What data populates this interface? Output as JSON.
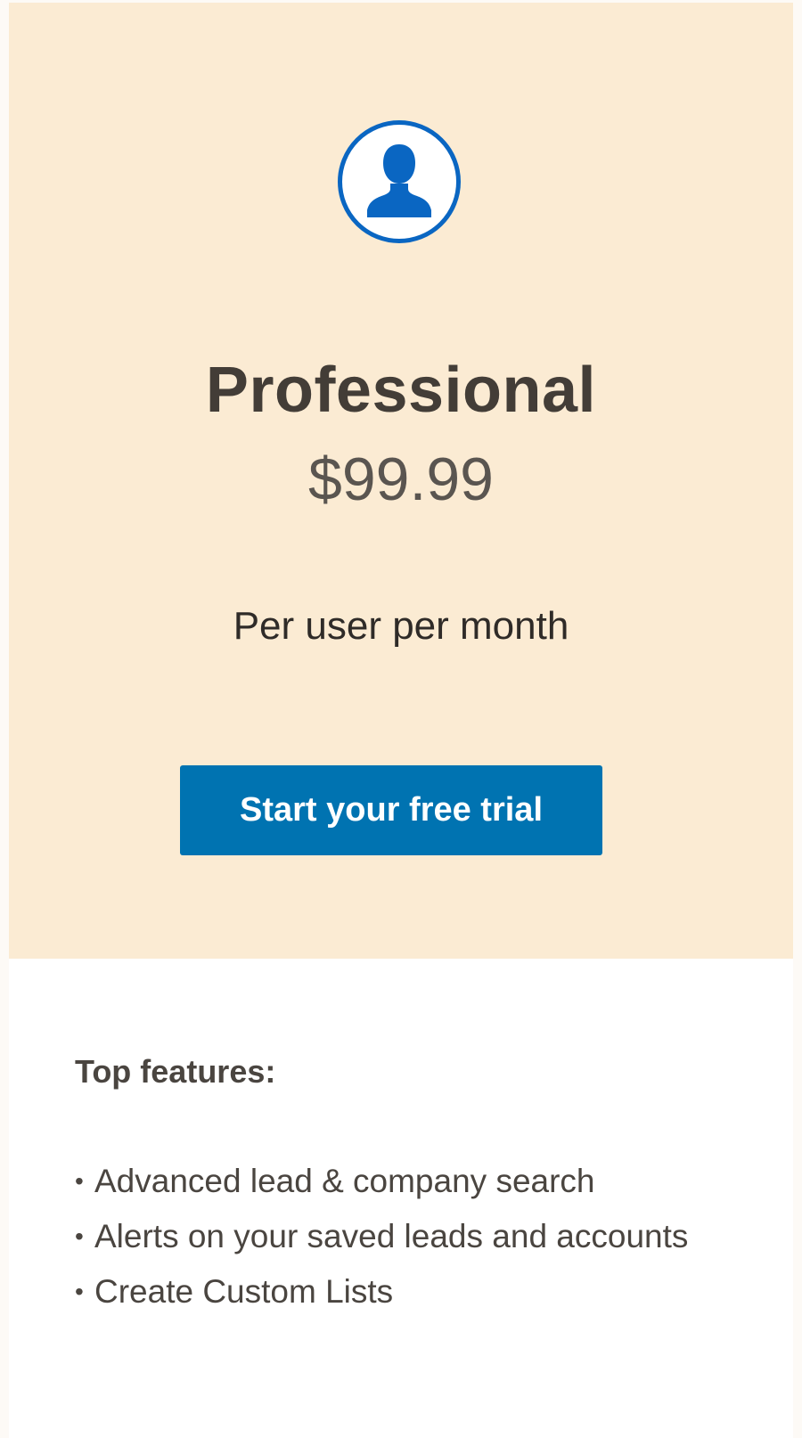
{
  "plan": {
    "icon": "user-avatar-icon",
    "name": "Professional",
    "price": "$99.99",
    "period": "Per user per month",
    "cta_label": "Start your free trial"
  },
  "features": {
    "title": "Top features:",
    "bullet": "•",
    "items": [
      "Advanced lead & company search",
      "Alerts on your saved leads and accounts",
      "Create Custom Lists"
    ]
  },
  "colors": {
    "hero_background": "#fbebd3",
    "accent_blue": "#0a66c2",
    "button_blue": "#0073b1",
    "card_background": "#ffffff"
  }
}
